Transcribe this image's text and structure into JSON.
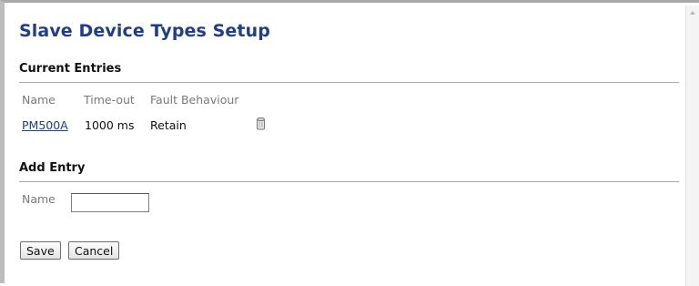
{
  "page": {
    "title": "Slave Device Types Setup"
  },
  "current_entries": {
    "heading": "Current Entries",
    "columns": [
      "Name",
      "Time-out",
      "Fault Behaviour"
    ],
    "rows": [
      {
        "name": "PM500A",
        "timeout": "1000 ms",
        "fault_behaviour": "Retain",
        "delete_icon": "trash-can-icon"
      }
    ]
  },
  "add_entry": {
    "heading": "Add Entry",
    "name_label": "Name",
    "name_value": "",
    "name_placeholder": ""
  },
  "buttons": {
    "save": "Save",
    "cancel": "Cancel"
  },
  "colors": {
    "title": "#1f3d8f",
    "link": "#1f3d8f",
    "label_gray": "#7a7a7a",
    "rule": "#a8a8a8"
  }
}
